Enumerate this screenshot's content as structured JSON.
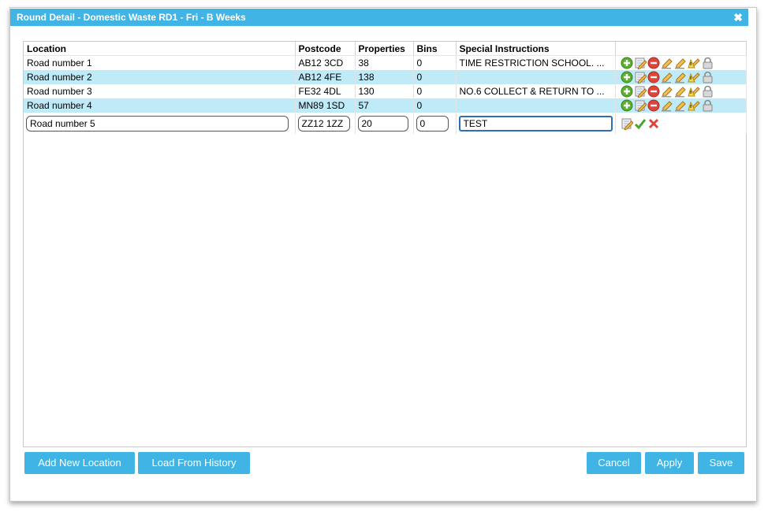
{
  "dialog": {
    "title": "Round Detail - Domestic Waste RD1 - Fri - B Weeks",
    "close_glyph": "✖"
  },
  "table": {
    "columns": [
      "Location",
      "Postcode",
      "Properties",
      "Bins",
      "Special Instructions"
    ],
    "rows": [
      {
        "location": "Road number 1",
        "postcode": "AB12 3CD",
        "properties": "38",
        "bins": "0",
        "instructions": "TIME RESTRICTION SCHOOL. ..."
      },
      {
        "location": "Road number 2",
        "postcode": "AB12 4FE",
        "properties": "138",
        "bins": "0",
        "instructions": ""
      },
      {
        "location": "Road number 3",
        "postcode": "FE32 4DL",
        "properties": "130",
        "bins": "0",
        "instructions": "NO.6 COLLECT & RETURN TO ..."
      },
      {
        "location": "Road number 4",
        "postcode": "MN89 1SD",
        "properties": "57",
        "bins": "0",
        "instructions": ""
      }
    ],
    "edit_row": {
      "location": "Road number 5",
      "postcode": "ZZ12 1ZZ",
      "properties": "20",
      "bins": "0",
      "instructions": "TEST"
    },
    "row_action_icons": [
      "add-icon",
      "edit-icon",
      "remove-icon",
      "edit-pencil-icon",
      "edit-pencil-icon",
      "warning-icon",
      "lock-icon"
    ],
    "edit_action_icons": [
      "edit-icon",
      "confirm-check-icon",
      "cancel-x-icon"
    ]
  },
  "buttons": {
    "add_new_location": "Add New Location",
    "load_from_history": "Load From History",
    "cancel": "Cancel",
    "apply": "Apply",
    "save": "Save"
  },
  "colors": {
    "accent": "#3fb4e5",
    "alt_row": "#bfeaf8"
  }
}
